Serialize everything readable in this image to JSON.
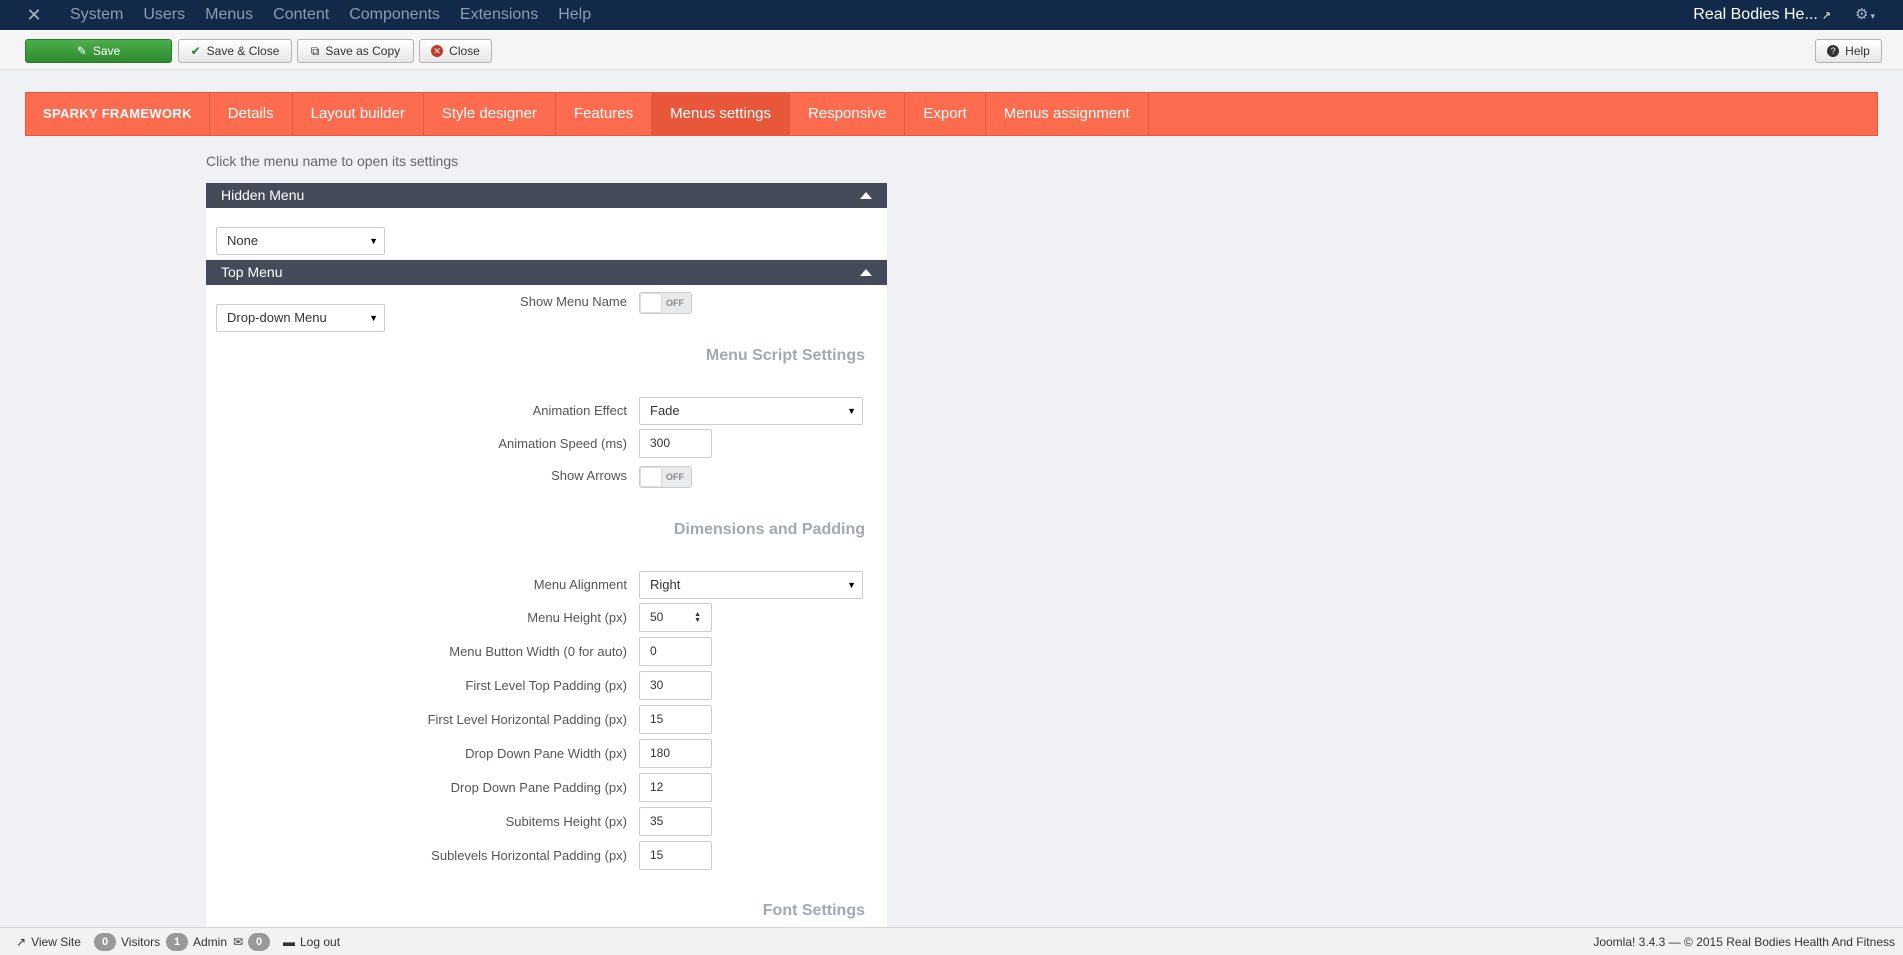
{
  "topbar": {
    "menu": [
      "System",
      "Users",
      "Menus",
      "Content",
      "Components",
      "Extensions",
      "Help"
    ],
    "site_name": "Real Bodies He...",
    "icons": {
      "logo": "joomla-logo-icon",
      "external": "external-link-icon",
      "settings": "gear-icon"
    }
  },
  "toolbar": {
    "save": "Save",
    "save_close": "Save & Close",
    "save_copy": "Save as Copy",
    "close": "Close",
    "help": "Help"
  },
  "tabs": {
    "brand": "SPARKY FRAMEWORK",
    "items": [
      "Details",
      "Layout builder",
      "Style designer",
      "Features",
      "Menus settings",
      "Responsive",
      "Export",
      "Menus assignment"
    ],
    "active": "Menus settings"
  },
  "hint": "Click the menu name to open its settings",
  "hidden_menu": {
    "title": "Hidden Menu",
    "type_value": "None"
  },
  "top_menu": {
    "title": "Top Menu",
    "type_value": "Drop-down Menu",
    "show_menu_name_label": "Show Menu Name",
    "show_menu_name_value": "OFF",
    "script_settings_title": "Menu Script Settings",
    "animation_effect_label": "Animation Effect",
    "animation_effect_value": "Fade",
    "animation_speed_label": "Animation Speed (ms)",
    "animation_speed_value": "300",
    "show_arrows_label": "Show Arrows",
    "show_arrows_value": "OFF",
    "dimensions_title": "Dimensions and Padding",
    "menu_alignment_label": "Menu Alignment",
    "menu_alignment_value": "Right",
    "menu_height_label": "Menu Height (px)",
    "menu_height_value": "50",
    "button_width_label": "Menu Button Width (0 for auto)",
    "button_width_value": "0",
    "top_padding_label": "First Level Top Padding (px)",
    "top_padding_value": "30",
    "horizontal_padding_label": "First Level Horizontal Padding (px)",
    "horizontal_padding_value": "15",
    "pane_width_label": "Drop Down Pane Width (px)",
    "pane_width_value": "180",
    "pane_padding_label": "Drop Down Pane Padding (px)",
    "pane_padding_value": "12",
    "subitems_height_label": "Subitems Height (px)",
    "subitems_height_value": "35",
    "sublevels_padding_label": "Sublevels Horizontal Padding (px)",
    "sublevels_padding_value": "15",
    "font_settings_title": "Font Settings"
  },
  "status": {
    "view_site": "View Site",
    "visitors_count": "0",
    "visitors_label": "Visitors",
    "admin_count": "1",
    "admin_label": "Admin",
    "messages_count": "0",
    "logout": "Log out",
    "footer": "Joomla! 3.4.3  —  © 2015 Real Bodies Health And Fitness"
  }
}
